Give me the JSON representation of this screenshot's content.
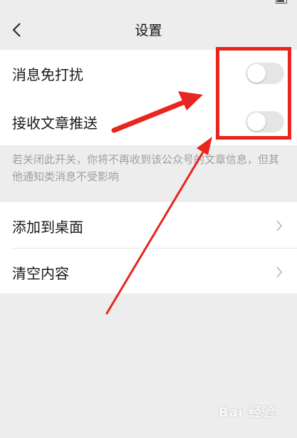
{
  "statusbar": {
    "left": "",
    "right": ""
  },
  "header": {
    "title": "设置"
  },
  "group1": {
    "rows": [
      {
        "label": "消息免打扰",
        "toggle_on": false
      },
      {
        "label": "接收文章推送",
        "toggle_on": false
      }
    ]
  },
  "hint": "若关闭此开关，你将不再收到该公众号的文章信息，但其他通知类消息不受影响",
  "group2": {
    "rows": [
      {
        "label": "添加到桌面"
      },
      {
        "label": "清空内容"
      }
    ]
  },
  "annotation": {
    "color": "#e8251e"
  },
  "watermark": "Bai 经验",
  "colors": {
    "background": "#ededed",
    "card": "#ffffff",
    "toggle_off": "#e5e5e5",
    "hint_text": "#9e9e9e"
  }
}
